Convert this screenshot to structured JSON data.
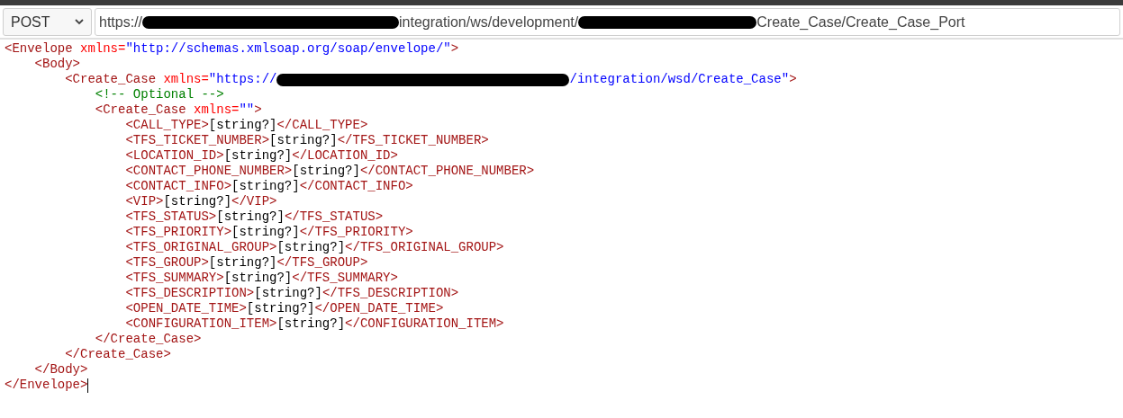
{
  "request": {
    "method": "POST",
    "url": [
      {
        "kind": "text",
        "text": "https://"
      },
      {
        "kind": "redaction"
      },
      {
        "kind": "text",
        "text": "integration/ws/development/"
      },
      {
        "kind": "redaction"
      },
      {
        "kind": "text",
        "text": "Create_Case/Create_Case_Port"
      }
    ]
  },
  "editor": {
    "lines": [
      {
        "segments": [
          {
            "kind": "tag",
            "text": "<Envelope "
          },
          {
            "kind": "attr",
            "text": "xmlns="
          },
          {
            "kind": "value",
            "text": "\"http://schemas.xmlsoap.org/soap/envelope/\""
          },
          {
            "kind": "tag",
            "text": ">"
          }
        ]
      },
      {
        "segments": [
          {
            "kind": "tag",
            "text": "    <Body>"
          }
        ]
      },
      {
        "segments": [
          {
            "kind": "tag",
            "text": "        <Create_Case "
          },
          {
            "kind": "attr",
            "text": "xmlns="
          },
          {
            "kind": "value",
            "text": "\"https://"
          },
          {
            "kind": "redaction"
          },
          {
            "kind": "value",
            "text": "/integration/wsd/Create_Case\""
          },
          {
            "kind": "tag",
            "text": ">"
          }
        ]
      },
      {
        "segments": [
          {
            "kind": "comment",
            "text": "            <!-- Optional -->"
          }
        ]
      },
      {
        "segments": [
          {
            "kind": "tag",
            "text": "            <Create_Case "
          },
          {
            "kind": "attr",
            "text": "xmlns="
          },
          {
            "kind": "value",
            "text": "\"\""
          },
          {
            "kind": "tag",
            "text": ">"
          }
        ]
      },
      {
        "segments": [
          {
            "kind": "tag",
            "text": "                <CALL_TYPE>"
          },
          {
            "kind": "text",
            "text": "[string?]"
          },
          {
            "kind": "tag",
            "text": "</CALL_TYPE>"
          }
        ]
      },
      {
        "segments": [
          {
            "kind": "tag",
            "text": "                <TFS_TICKET_NUMBER>"
          },
          {
            "kind": "text",
            "text": "[string?]"
          },
          {
            "kind": "tag",
            "text": "</TFS_TICKET_NUMBER>"
          }
        ]
      },
      {
        "segments": [
          {
            "kind": "tag",
            "text": "                <LOCATION_ID>"
          },
          {
            "kind": "text",
            "text": "[string?]"
          },
          {
            "kind": "tag",
            "text": "</LOCATION_ID>"
          }
        ]
      },
      {
        "segments": [
          {
            "kind": "tag",
            "text": "                <CONTACT_PHONE_NUMBER>"
          },
          {
            "kind": "text",
            "text": "[string?]"
          },
          {
            "kind": "tag",
            "text": "</CONTACT_PHONE_NUMBER>"
          }
        ]
      },
      {
        "segments": [
          {
            "kind": "tag",
            "text": "                <CONTACT_INFO>"
          },
          {
            "kind": "text",
            "text": "[string?]"
          },
          {
            "kind": "tag",
            "text": "</CONTACT_INFO>"
          }
        ]
      },
      {
        "segments": [
          {
            "kind": "tag",
            "text": "                <VIP>"
          },
          {
            "kind": "text",
            "text": "[string?]"
          },
          {
            "kind": "tag",
            "text": "</VIP>"
          }
        ]
      },
      {
        "segments": [
          {
            "kind": "tag",
            "text": "                <TFS_STATUS>"
          },
          {
            "kind": "text",
            "text": "[string?]"
          },
          {
            "kind": "tag",
            "text": "</TFS_STATUS>"
          }
        ]
      },
      {
        "segments": [
          {
            "kind": "tag",
            "text": "                <TFS_PRIORITY>"
          },
          {
            "kind": "text",
            "text": "[string?]"
          },
          {
            "kind": "tag",
            "text": "</TFS_PRIORITY>"
          }
        ]
      },
      {
        "segments": [
          {
            "kind": "tag",
            "text": "                <TFS_ORIGINAL_GROUP>"
          },
          {
            "kind": "text",
            "text": "[string?]"
          },
          {
            "kind": "tag",
            "text": "</TFS_ORIGINAL_GROUP>"
          }
        ]
      },
      {
        "segments": [
          {
            "kind": "tag",
            "text": "                <TFS_GROUP>"
          },
          {
            "kind": "text",
            "text": "[string?]"
          },
          {
            "kind": "tag",
            "text": "</TFS_GROUP>"
          }
        ]
      },
      {
        "segments": [
          {
            "kind": "tag",
            "text": "                <TFS_SUMMARY>"
          },
          {
            "kind": "text",
            "text": "[string?]"
          },
          {
            "kind": "tag",
            "text": "</TFS_SUMMARY>"
          }
        ]
      },
      {
        "segments": [
          {
            "kind": "tag",
            "text": "                <TFS_DESCRIPTION>"
          },
          {
            "kind": "text",
            "text": "[string?]"
          },
          {
            "kind": "tag",
            "text": "</TFS_DESCRIPTION>"
          }
        ]
      },
      {
        "segments": [
          {
            "kind": "tag",
            "text": "                <OPEN_DATE_TIME>"
          },
          {
            "kind": "text",
            "text": "[string?]"
          },
          {
            "kind": "tag",
            "text": "</OPEN_DATE_TIME>"
          }
        ]
      },
      {
        "segments": [
          {
            "kind": "tag",
            "text": "                <CONFIGURATION_ITEM>"
          },
          {
            "kind": "text",
            "text": "[string?]"
          },
          {
            "kind": "tag",
            "text": "</CONFIGURATION_ITEM>"
          }
        ]
      },
      {
        "segments": [
          {
            "kind": "tag",
            "text": "            </Create_Case>"
          }
        ]
      },
      {
        "segments": [
          {
            "kind": "tag",
            "text": "        </Create_Case>"
          }
        ]
      },
      {
        "segments": [
          {
            "kind": "tag",
            "text": "    </Body>"
          }
        ]
      },
      {
        "segments": [
          {
            "kind": "tag",
            "text": "</Envelope>"
          }
        ],
        "cursor": true
      }
    ]
  }
}
